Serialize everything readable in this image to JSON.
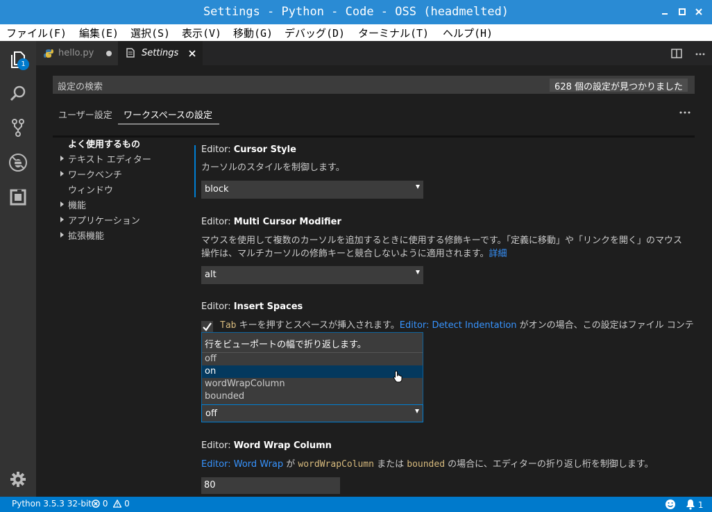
{
  "window": {
    "title": "Settings - Python - Code - OSS (headmelted)"
  },
  "menubar": {
    "items": [
      "ファイル(F)",
      "編集(E)",
      "選択(S)",
      "表示(V)",
      "移動(G)",
      "デバッグ(D)",
      "ターミナル(T)",
      "ヘルプ(H)"
    ]
  },
  "activitybar": {
    "explorer_badge": "1"
  },
  "tabs": [
    {
      "label": "hello.py",
      "state": "modified"
    },
    {
      "label": "Settings",
      "state": "active"
    }
  ],
  "settings": {
    "search_placeholder": "設定の検索",
    "result_count": "628 個の設定が見つかりました",
    "tabs": [
      "ユーザー設定",
      "ワークスペースの設定"
    ],
    "toc": [
      {
        "label": "よく使用するもの",
        "caret": false,
        "bold": true
      },
      {
        "label": "テキスト エディター",
        "caret": true
      },
      {
        "label": "ワークベンチ",
        "caret": true
      },
      {
        "label": "ウィンドウ",
        "caret": false
      },
      {
        "label": "機能",
        "caret": true
      },
      {
        "label": "アプリケーション",
        "caret": true
      },
      {
        "label": "拡張機能",
        "caret": true
      }
    ],
    "cursor_style": {
      "category": "Editor: ",
      "name": "Cursor Style",
      "description": "カーソルのスタイルを制御します。",
      "value": "block"
    },
    "multi_cursor": {
      "category": "Editor: ",
      "name": "Multi Cursor Modifier",
      "description_line1": "マウスを使用して複数のカーソルを追加するときに使用する修飾キーです。「定義に移動」や「リンクを開く」のマウス",
      "description_line2": "操作は、マルチカーソルの修飾キーと競合しないように適用されます。",
      "link": "詳細",
      "value": "alt"
    },
    "insert_spaces": {
      "category": "Editor: ",
      "name": "Insert Spaces",
      "code": "Tab",
      "description_a": " キーを押すとスペースが挿入されます。",
      "link": "Editor: Detect Indentation",
      "description_b": " がオンの場合、この設定はファイル コンテ"
    },
    "word_wrap": {
      "dropdown_description": "行をビューポートの幅で折り返します。",
      "options": [
        "off",
        "on",
        "wordWrapColumn",
        "bounded"
      ],
      "hovered": "on",
      "value": "off"
    },
    "word_wrap_column": {
      "category": "Editor: ",
      "name": "Word Wrap Column",
      "link": "Editor: Word Wrap",
      "text_a": " が ",
      "code_a": "wordWrapColumn",
      "text_b": " または ",
      "code_b": "bounded",
      "text_c": " の場合に、エディターの折り返し桁を制御します。",
      "value": "80"
    }
  },
  "statusbar": {
    "python": "Python 3.5.3 32-bit",
    "errors": "0",
    "warnings": "0"
  },
  "colors": {
    "accent": "#007acc",
    "titlebar": "#2a8bd4",
    "link": "#3794ff"
  }
}
